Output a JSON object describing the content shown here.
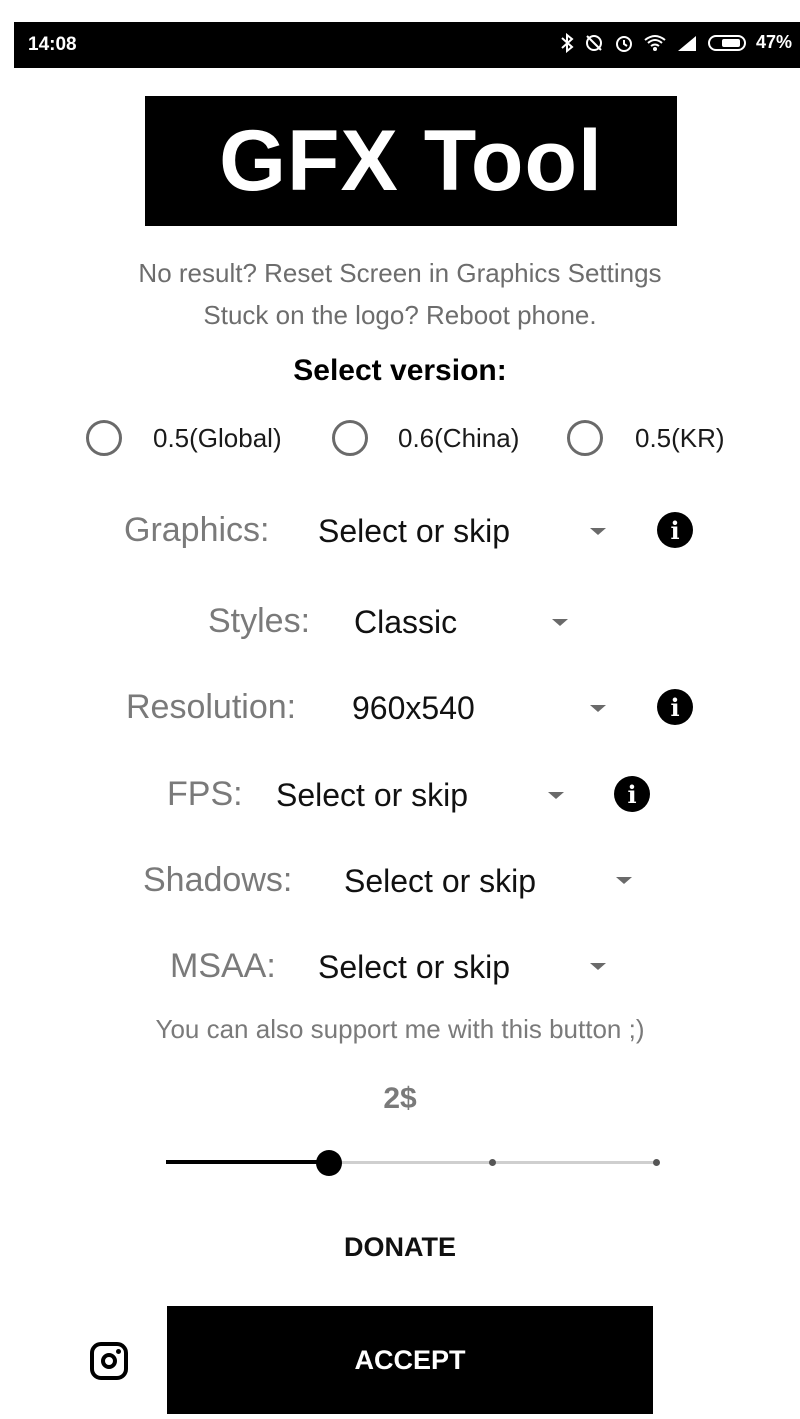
{
  "status_bar": {
    "time": "14:08",
    "battery_percent": "47%",
    "icons": [
      "bluetooth-icon",
      "sync-off-icon",
      "alarm-icon",
      "wifi-icon",
      "signal-icon",
      "battery-icon"
    ]
  },
  "app": {
    "title": "GFX Tool",
    "hint_line1": "No result? Reset Screen in Graphics Settings",
    "hint_line2": "Stuck on the logo? Reboot phone."
  },
  "version": {
    "heading": "Select version:",
    "options": [
      {
        "label": "0.5(Global)",
        "selected": false
      },
      {
        "label": "0.6(China)",
        "selected": false
      },
      {
        "label": "0.5(KR)",
        "selected": false
      }
    ]
  },
  "settings": {
    "graphics": {
      "label": "Graphics:",
      "value": "Select or skip"
    },
    "styles": {
      "label": "Styles:",
      "value": "Classic"
    },
    "resolution": {
      "label": "Resolution:",
      "value": "960x540"
    },
    "fps": {
      "label": "FPS:",
      "value": "Select or skip"
    },
    "shadows": {
      "label": "Shadows:",
      "value": "Select or skip"
    },
    "msaa": {
      "label": "MSAA:",
      "value": "Select or skip"
    }
  },
  "support": {
    "text": "You can also support me with this button ;)",
    "amount": "2$",
    "slider_value_index": 1,
    "slider_steps": 4,
    "donate_label": "DONATE"
  },
  "footer": {
    "accept_label": "ACCEPT",
    "info_glyph": "i"
  },
  "colors": {
    "primary": "#000000",
    "label_gray": "#7a7a7a",
    "background": "#ffffff"
  }
}
